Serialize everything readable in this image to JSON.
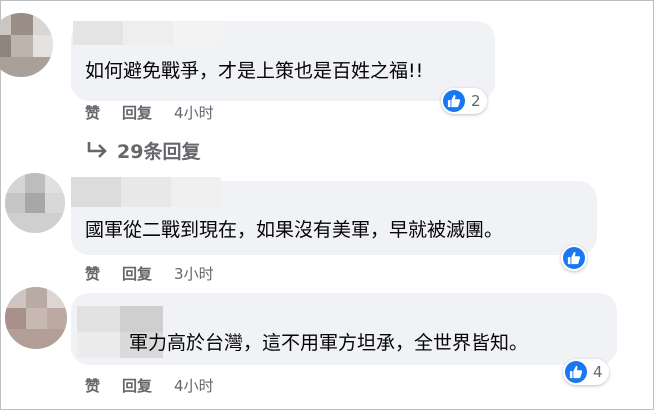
{
  "comments": [
    {
      "text": "如何避免戰爭，才是上策也是百姓之福!!",
      "like_label": "赞",
      "reply_label": "回复",
      "time": "4小时",
      "reaction_count": "2"
    },
    {
      "text": "國軍從二戰到現在，如果沒有美軍，早就被滅團。",
      "like_label": "赞",
      "reply_label": "回复",
      "time": "3小时",
      "reaction_count": ""
    },
    {
      "text": "軍力高於台灣，這不用軍方坦承，全世界皆知。",
      "like_label": "赞",
      "reply_label": "回复",
      "time": "4小时",
      "reaction_count": "4"
    }
  ],
  "view_replies": {
    "label": "29条回复"
  },
  "icons": {
    "like": "thumbs-up-icon",
    "reply_arrow": "reply-arrow-icon"
  },
  "colors": {
    "like_blue": "#1877f2",
    "bubble_bg": "#f0f2f5",
    "secondary_text": "#65676b"
  }
}
